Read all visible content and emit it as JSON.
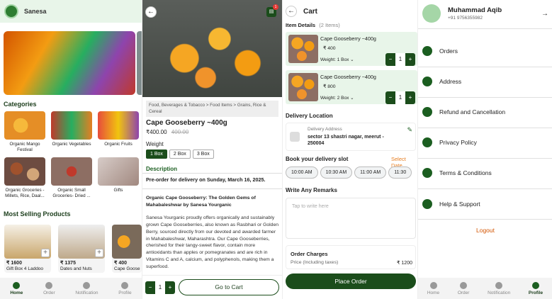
{
  "home": {
    "brand": "Sanesa",
    "categories_title": "Categories",
    "categories": [
      "Organic Mango Festival",
      "Organic Vegetables",
      "Organic Fruits",
      "Organic Groceries - Millets, Rice, Daal...",
      "Organic Small Groceries- Dried ...",
      "Gifts"
    ],
    "most_selling_title": "Most Selling Products",
    "products": [
      {
        "price": "₹ 1600",
        "name": "Gift Box 4 Laddoo"
      },
      {
        "price": "₹ 1375",
        "name": "Dates and Nuts"
      },
      {
        "price": "₹ 400",
        "name": "Cape Goose"
      }
    ],
    "nav": [
      "Home",
      "Order",
      "Notification",
      "Profile"
    ]
  },
  "product": {
    "cart_badge": "1",
    "breadcrumb": "Food, Beverages & Tobacco > Food Items > Grains, Rice & Cereal",
    "title": "Cape Gooseberry ~400g",
    "price": "₹400.00",
    "old_price": "400.00",
    "weight_label": "Weight",
    "weights": [
      "1 Box",
      "2 Box",
      "3 Box"
    ],
    "desc_title": "Description",
    "preorder": "Pre-order for delivery on Sunday, March 16, 2025.",
    "subtitle": "Organic Cape Gooseberry: The Golden Gems of Mahabaleshwar by Sanesa Yourganic",
    "body": "Sanesa Yourganic proudly offers organically and sustainably grown Cape Gooseberries, also known as Rasbhari or Golden Berry, sourced directly from our devoted and awarded farmer in Mahabaleshwar, Maharashtra. Our Cape Gooseberries, cherished for their tangy-sweet flavor, contain more antioxidants than apples or pomegranates and are rich in Vitamins C and A, calcium, and polyphenols, making them a superfood.",
    "qty": "1",
    "cta": "Go to Cart"
  },
  "cart": {
    "title": "Cart",
    "item_details": "Item Details",
    "item_count": "(2 Items)",
    "items": [
      {
        "name": "Cape Gooseberry ~400g",
        "price": "₹ 400",
        "weight": "Weight: 1 Box",
        "qty": "1"
      },
      {
        "name": "Cape Gooseberry ~400g",
        "price": "₹ 800",
        "weight": "Weight: 2 Box",
        "qty": "1"
      }
    ],
    "delivery_location": "Delivery Location",
    "address_label": "Delivery Address",
    "address": "sector 13 shastri nagar, meerut - 250004",
    "slot_title": "Book your delivery slot",
    "select_date": "Select Date",
    "slots": [
      "10:00 AM",
      "10:30 AM",
      "11:00 AM",
      "11:30"
    ],
    "remarks_title": "Write Any Remarks",
    "remarks_placeholder": "Tap to write here",
    "order_charges": "Order Charges",
    "price_label": "Price (Including taxes)",
    "price_value": "₹ 1200",
    "place_order": "Place Order"
  },
  "profile": {
    "name": "Muhammad Aqib",
    "phone": "+91 9756355982",
    "menu": [
      "Orders",
      "Address",
      "Refund and Cancellation",
      "Privacy Policy",
      "Terms & Conditions",
      "Help & Support"
    ],
    "logout": "Logout",
    "nav": [
      "Home",
      "Order",
      "Notification",
      "Profile"
    ]
  }
}
